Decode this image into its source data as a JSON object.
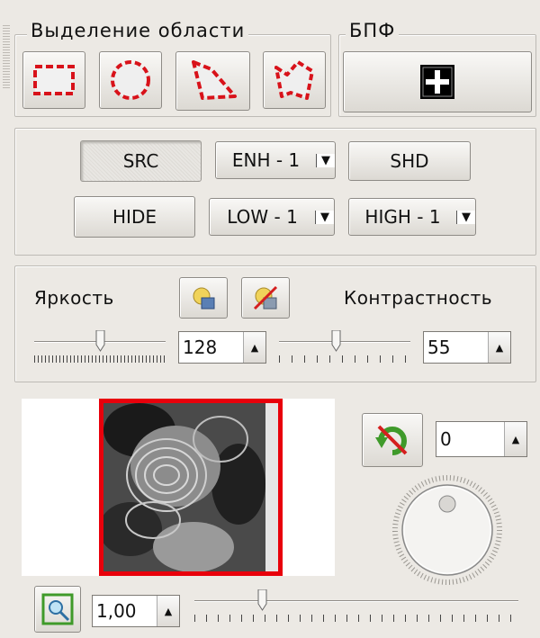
{
  "selection": {
    "title": "Выделение области",
    "tools": [
      "rect-select-icon",
      "ellipse-select-icon",
      "polygon-select-icon",
      "freeform-select-icon"
    ]
  },
  "fft": {
    "title": "БПФ",
    "icon": "fft-cross-icon"
  },
  "modes": {
    "src": "SRC",
    "enh": "ENH - 1",
    "shd": "SHD",
    "hide": "HIDE",
    "low": "LOW - 1",
    "high": "HIGH - 1"
  },
  "adjust": {
    "brightness_label": "Яркость",
    "contrast_label": "Контрастность",
    "brightness_value": "128",
    "contrast_value": "55",
    "brightness_level": 0.5,
    "contrast_level": 0.43
  },
  "rotation": {
    "value": "0",
    "icon": "rotate-reset-icon"
  },
  "zoom": {
    "value": "1,00",
    "icon": "zoom-fit-icon",
    "level": 0.2
  },
  "colors": {
    "frame": "#e8000b",
    "selection_dash": "#d8121a"
  }
}
